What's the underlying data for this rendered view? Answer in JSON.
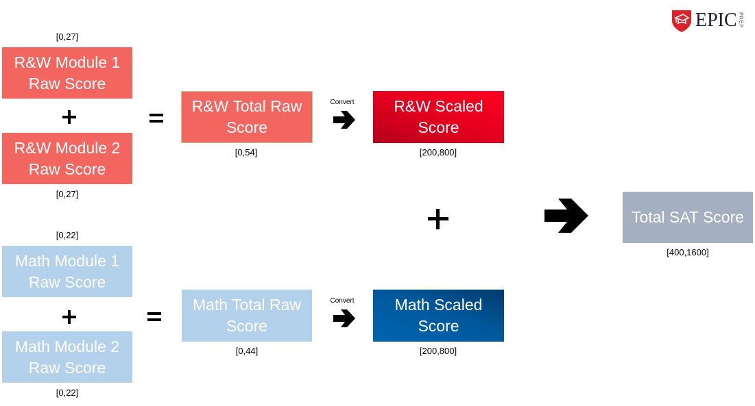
{
  "logo": {
    "brand": "EPIC",
    "sub": "PREP",
    "icon": "shield-graduation-cap-icon",
    "color": "#d9222a"
  },
  "colors": {
    "rw_raw": "#f2665f",
    "rw_scaled": "#e0001d",
    "math_raw": "#b3d1ea",
    "math_scaled": "#00589c",
    "total_sat": "#a4afc0"
  },
  "rw": {
    "module1": {
      "label": "R&W Module 1\nRaw Score",
      "range": "[0,27]"
    },
    "module2": {
      "label": "R&W Module 2\nRaw Score",
      "range": "[0,27]"
    },
    "total_raw": {
      "label": "R&W Total Raw\nScore",
      "range": "[0,54]"
    },
    "scaled": {
      "label": "R&W Scaled\nScore",
      "range": "[200,800]"
    },
    "convert_label": "Convert"
  },
  "math": {
    "module1": {
      "label": "Math Module 1\nRaw Score",
      "range": "[0,22]"
    },
    "module2": {
      "label": "Math Module 2\nRaw Score",
      "range": "[0,22]"
    },
    "total_raw": {
      "label": "Math Total Raw\nScore",
      "range": "[0,44]"
    },
    "scaled": {
      "label": "Math Scaled\nScore",
      "range": "[200,800]"
    },
    "convert_label": "Convert"
  },
  "total": {
    "label": "Total SAT Score",
    "range": "[400,1600]"
  },
  "operators": {
    "plus": "+",
    "equals": "="
  }
}
